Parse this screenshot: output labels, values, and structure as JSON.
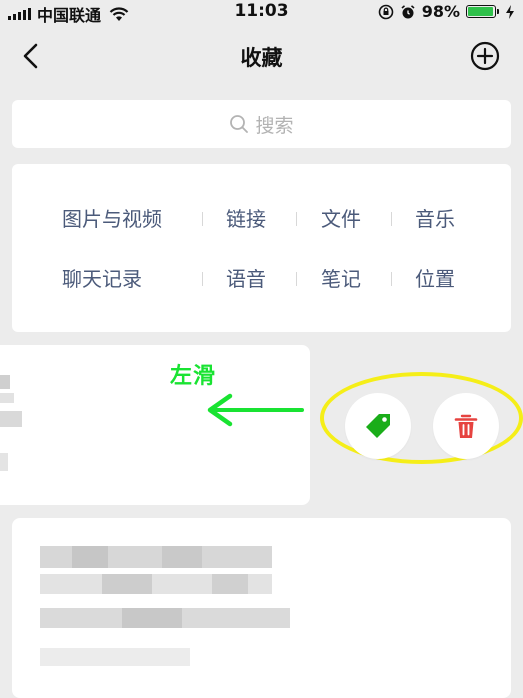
{
  "status_bar": {
    "carrier": "中国联通",
    "time": "11:03",
    "battery_percent": "98%",
    "battery_level": 0.98,
    "battery_color": "#2fc14b"
  },
  "nav": {
    "title": "收藏",
    "back_icon": "chevron-left-icon",
    "add_icon": "plus-circle-icon"
  },
  "search": {
    "placeholder": "搜索",
    "icon": "search-icon"
  },
  "categories": {
    "row1": [
      "图片与视频",
      "链接",
      "文件",
      "音乐"
    ],
    "row2": [
      "聊天记录",
      "语音",
      "笔记",
      "位置"
    ]
  },
  "annotation": {
    "swipe_label": "左滑",
    "arrow_color": "#19e332",
    "highlight_color": "#f5ee18"
  },
  "actions": {
    "tag_icon": "tag-icon",
    "tag_color": "#1aad19",
    "delete_icon": "trash-icon",
    "delete_color": "#e64340"
  },
  "colors": {
    "background": "#ececec",
    "category_text": "#4b5a7a"
  }
}
